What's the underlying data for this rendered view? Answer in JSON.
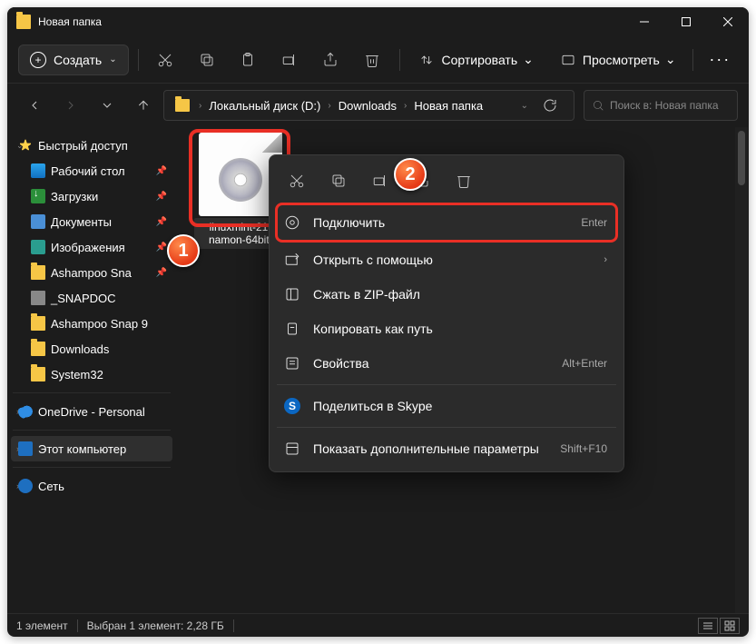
{
  "window": {
    "title": "Новая папка"
  },
  "toolbar": {
    "new_label": "Создать",
    "sort_label": "Сортировать",
    "view_label": "Просмотреть"
  },
  "breadcrumb": {
    "segments": [
      "Локальный диск (D:)",
      "Downloads",
      "Новая папка"
    ]
  },
  "search": {
    "placeholder": "Поиск в: Новая папка"
  },
  "sidebar": {
    "quick_label": "Быстрый доступ",
    "items": [
      {
        "label": "Рабочий стол",
        "pinned": true
      },
      {
        "label": "Загрузки",
        "pinned": true
      },
      {
        "label": "Документы",
        "pinned": true
      },
      {
        "label": "Изображения",
        "pinned": true
      },
      {
        "label": "Ashampoo Sna",
        "pinned": true
      },
      {
        "label": "_SNAPDOC",
        "pinned": false
      },
      {
        "label": "Ashampoo Snap 9",
        "pinned": false
      },
      {
        "label": "Downloads",
        "pinned": false
      },
      {
        "label": "System32",
        "pinned": false
      }
    ],
    "onedrive_label": "OneDrive - Personal",
    "pc_label": "Этот компьютер",
    "net_label": "Сеть"
  },
  "file": {
    "name": "linuxmint-21-namon-64bit."
  },
  "contextmenu": {
    "mount": "Подключить",
    "mount_shortcut": "Enter",
    "openwith": "Открыть с помощью",
    "zip": "Сжать в ZIP-файл",
    "copypath": "Копировать как путь",
    "properties": "Свойства",
    "properties_shortcut": "Alt+Enter",
    "skype": "Поделиться в Skype",
    "more": "Показать дополнительные параметры",
    "more_shortcut": "Shift+F10"
  },
  "status": {
    "count": "1 элемент",
    "selection": "Выбран 1 элемент: 2,28 ГБ"
  },
  "annotations": {
    "badge1": "1",
    "badge2": "2"
  }
}
